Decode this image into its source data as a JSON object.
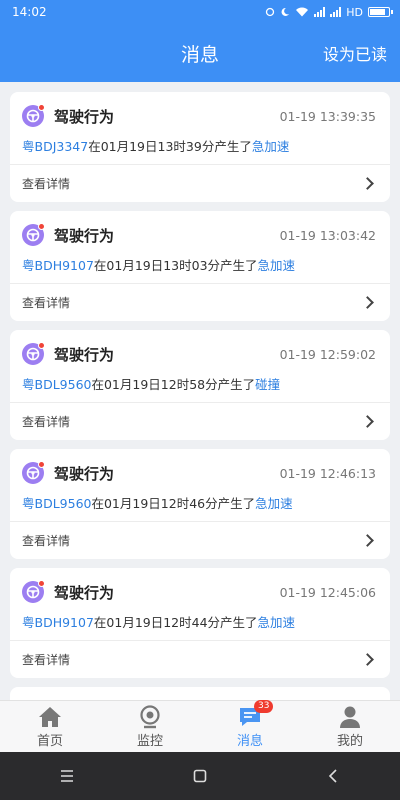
{
  "status": {
    "time": "14:02",
    "network": "HD"
  },
  "header": {
    "title": "消息",
    "action": "设为已读"
  },
  "messages": [
    {
      "title": "驾驶行为",
      "time": "01-19 13:39:35",
      "plate": "粤BDJ3347",
      "mid": "在01月19日13时39分产生了",
      "event": "急加速",
      "detail": "查看详情"
    },
    {
      "title": "驾驶行为",
      "time": "01-19 13:03:42",
      "plate": "粤BDH9107",
      "mid": "在01月19日13时03分产生了",
      "event": "急加速",
      "detail": "查看详情"
    },
    {
      "title": "驾驶行为",
      "time": "01-19 12:59:02",
      "plate": "粤BDL9560",
      "mid": "在01月19日12时58分产生了",
      "event": "碰撞",
      "detail": "查看详情"
    },
    {
      "title": "驾驶行为",
      "time": "01-19 12:46:13",
      "plate": "粤BDL9560",
      "mid": "在01月19日12时46分产生了",
      "event": "急加速",
      "detail": "查看详情"
    },
    {
      "title": "驾驶行为",
      "time": "01-19 12:45:06",
      "plate": "粤BDH9107",
      "mid": "在01月19日12时44分产生了",
      "event": "急加速",
      "detail": "查看详情"
    }
  ],
  "tabs": [
    {
      "label": "首页",
      "icon": "home-icon"
    },
    {
      "label": "监控",
      "icon": "camera-icon"
    },
    {
      "label": "消息",
      "icon": "message-icon",
      "badge": "33",
      "active": true
    },
    {
      "label": "我的",
      "icon": "user-icon"
    }
  ],
  "colors": {
    "primary": "#3d8ff5",
    "link": "#2d7fe0",
    "avatar": "#9c7ef1",
    "badge": "#ef3b2f"
  }
}
